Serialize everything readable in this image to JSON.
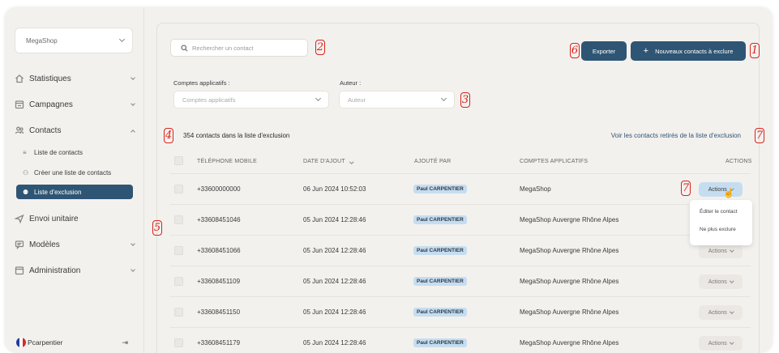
{
  "sidebar": {
    "shop_selector": "MegaShop",
    "items": [
      {
        "label": "Statistiques",
        "icon": "home-icon"
      },
      {
        "label": "Campagnes",
        "icon": "calendar-icon"
      },
      {
        "label": "Contacts",
        "icon": "users-icon"
      },
      {
        "label": "Envoi unitaire",
        "icon": "send-icon"
      },
      {
        "label": "Modèles",
        "icon": "message-icon"
      },
      {
        "label": "Administration",
        "icon": "window-icon"
      }
    ],
    "contacts_sub": [
      {
        "label": "Liste de contacts",
        "icon": "list-icon"
      },
      {
        "label": "Créer une liste de contacts",
        "icon": "user-plus-icon"
      },
      {
        "label": "Liste d'exclusion",
        "icon": "user-icon"
      }
    ],
    "user_name": "Pcarpentier"
  },
  "toolbar": {
    "search_placeholder": "Rechercher un contact",
    "export_label": "Exporter",
    "new_exclusion_label": "Nouveaux contacts à exclure"
  },
  "filters": {
    "accounts_label": "Comptes applicatifs :",
    "accounts_placeholder": "Comptes applicatifs",
    "author_label": "Auteur :",
    "author_placeholder": "Auteur"
  },
  "summary": {
    "count_text": "354 contacts dans la liste d'exclusion",
    "removed_link": "Voir les contacts retirés de la liste d'exclusion"
  },
  "table": {
    "headers": [
      "TÉLÉPHONE MOBILE",
      "DATE D'AJOUT",
      "AJOUTÉ PAR",
      "COMPTES APPLICATIFS",
      "ACTIONS"
    ],
    "action_label": "Actions",
    "rows": [
      {
        "phone": "+33600000000",
        "date": "06 Jun 2024 10:52:03",
        "author": "Paul CARPENTIER",
        "account": "MegaShop"
      },
      {
        "phone": "+33608451046",
        "date": "05 Jun 2024 12:28:46",
        "author": "Paul CARPENTIER",
        "account": "MegaShop Auvergne Rhône Alpes"
      },
      {
        "phone": "+33608451066",
        "date": "05 Jun 2024 12:28:46",
        "author": "Paul CARPENTIER",
        "account": "MegaShop Auvergne Rhône Alpes"
      },
      {
        "phone": "+33608451109",
        "date": "05 Jun 2024 12:28:46",
        "author": "Paul CARPENTIER",
        "account": "MegaShop Auvergne Rhône Alpes"
      },
      {
        "phone": "+33608451150",
        "date": "05 Jun 2024 12:28:46",
        "author": "Paul CARPENTIER",
        "account": "MegaShop Auvergne Rhône Alpes"
      },
      {
        "phone": "+33608451179",
        "date": "05 Jun 2024 12:28:46",
        "author": "Paul CARPENTIER",
        "account": "MegaShop Auvergne Rhône Alpes"
      }
    ]
  },
  "actions_menu": {
    "edit": "Éditer le contact",
    "unexclude": "Ne plus exclure"
  },
  "annotations": [
    "1",
    "2",
    "3",
    "4",
    "5",
    "6",
    "7",
    "7"
  ],
  "colors": {
    "accent": "#2f5574",
    "badge": "#c6ddf0",
    "annotation": "#d8231c"
  }
}
